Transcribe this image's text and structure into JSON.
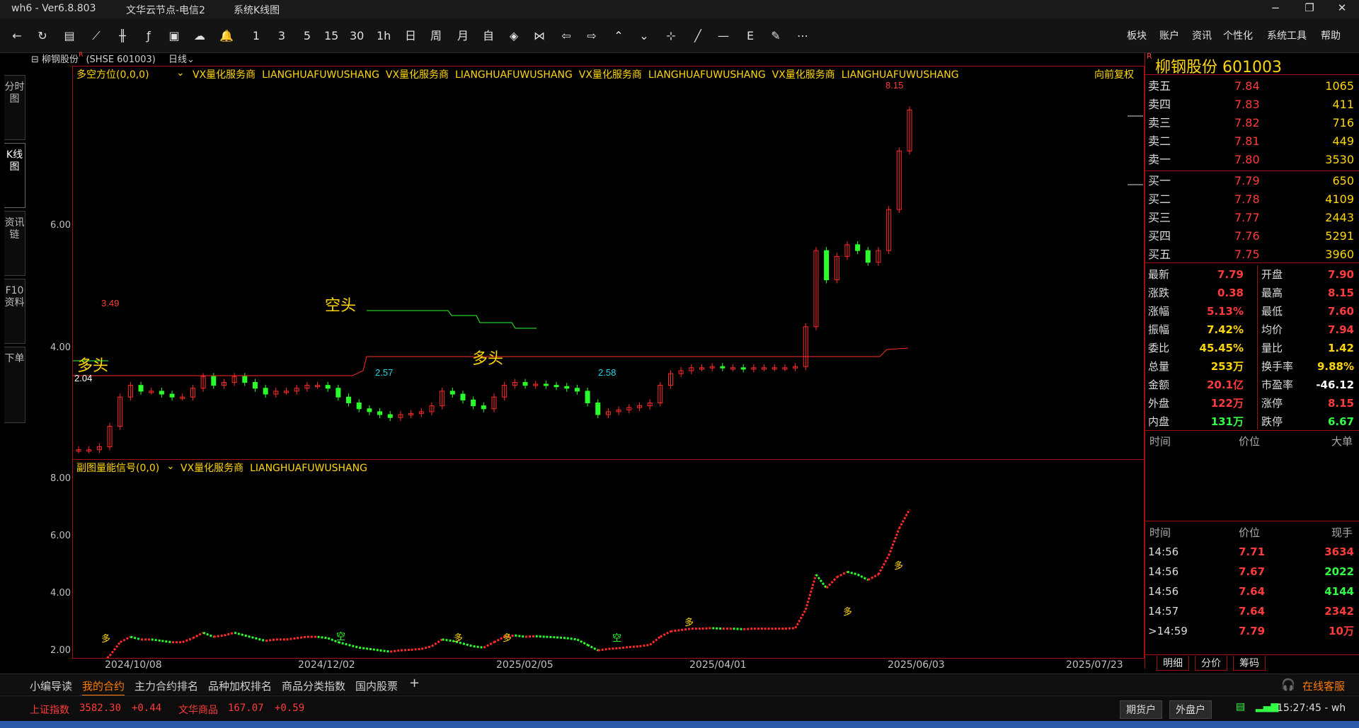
{
  "window": {
    "app": "wh6  -  Ver6.8.803",
    "server": "文华云节点-电信2",
    "view": "系统K线图",
    "controls": [
      "−",
      "❐",
      "✕"
    ]
  },
  "toolbar": {
    "icons": [
      "back-icon",
      "refresh-icon",
      "table-icon",
      "line-chart-icon",
      "candle-icon",
      "indicator-icon",
      "calc-icon",
      "cloud-icon",
      "bell-icon"
    ],
    "periods": [
      "1",
      "3",
      "5",
      "15",
      "30",
      "1h",
      "日",
      "周",
      "月",
      "自"
    ],
    "menus": [
      "板块",
      "账户",
      "资讯",
      "个性化",
      "系统工具",
      "帮助"
    ]
  },
  "sidetabs": [
    "分时图",
    "K线图",
    "资讯链",
    "F10资料",
    "下单"
  ],
  "instrument": {
    "name": "柳钢股份",
    "code_label": "(SHSE 601003)",
    "period": "日线"
  },
  "main_chart": {
    "indicator": "多空方位(0,0,0)",
    "promo": [
      "VX量化服务商",
      "LIANGHUAFUWUSHANG",
      "VX量化服务商",
      "LIANGHUAFUWUSHANG",
      "VX量化服务商",
      "LIANGHUAFUWUSHANG",
      "VX量化服务商",
      "LIANGHUAFUWUSHANG"
    ],
    "adjust": "向前复权",
    "yticks": [
      "6.00",
      "4.00"
    ],
    "labels": {
      "high": "8.15",
      "local_high": "3.49",
      "low1": "2.57",
      "low2": "2.58",
      "start": "2.04"
    },
    "signals": {
      "kong": "空头",
      "duo1": "多头",
      "duo2": "多头"
    }
  },
  "sub_chart": {
    "indicator": "副图量能信号(0,0)",
    "promo": [
      "VX量化服务商",
      "LIANGHUAFUWUSHANG"
    ],
    "yticks": [
      "8.00",
      "6.00",
      "4.00",
      "2.00"
    ],
    "markers": [
      "多",
      "空",
      "多",
      "多",
      "空",
      "多",
      "多",
      "多"
    ]
  },
  "xaxis": [
    "2024/10/08",
    "2024/12/02",
    "2025/02/05",
    "2025/04/01",
    "2025/06/03",
    "2025/07/23"
  ],
  "quote": {
    "title": "柳钢股份  601003",
    "asks": [
      {
        "label": "卖五",
        "price": "7.84",
        "vol": "1065"
      },
      {
        "label": "卖四",
        "price": "7.83",
        "vol": "411"
      },
      {
        "label": "卖三",
        "price": "7.82",
        "vol": "716"
      },
      {
        "label": "卖二",
        "price": "7.81",
        "vol": "449"
      },
      {
        "label": "卖一",
        "price": "7.80",
        "vol": "3530"
      }
    ],
    "bids": [
      {
        "label": "买一",
        "price": "7.79",
        "vol": "650"
      },
      {
        "label": "买二",
        "price": "7.78",
        "vol": "4109"
      },
      {
        "label": "买三",
        "price": "7.77",
        "vol": "2443"
      },
      {
        "label": "买四",
        "price": "7.76",
        "vol": "5291"
      },
      {
        "label": "买五",
        "price": "7.75",
        "vol": "3960"
      }
    ],
    "stats": [
      {
        "l1": "最新",
        "v1": "7.79",
        "c1": "red",
        "l2": "开盘",
        "v2": "7.90",
        "c2": "red"
      },
      {
        "l1": "涨跌",
        "v1": "0.38",
        "c1": "red",
        "l2": "最高",
        "v2": "8.15",
        "c2": "red"
      },
      {
        "l1": "涨幅",
        "v1": "5.13%",
        "c1": "red",
        "l2": "最低",
        "v2": "7.60",
        "c2": "red"
      },
      {
        "l1": "振幅",
        "v1": "7.42%",
        "c1": "yellow",
        "l2": "均价",
        "v2": "7.94",
        "c2": "red"
      },
      {
        "l1": "委比",
        "v1": "45.45%",
        "c1": "yellow",
        "l2": "量比",
        "v2": "1.42",
        "c2": "yellow"
      },
      {
        "l1": "总量",
        "v1": "253万",
        "c1": "yellow",
        "l2": "换手率",
        "v2": "9.88%",
        "c2": "yellow"
      },
      {
        "l1": "金额",
        "v1": "20.1亿",
        "c1": "red",
        "l2": "市盈率",
        "v2": "-46.12",
        "c2": "white"
      },
      {
        "l1": "外盘",
        "v1": "122万",
        "c1": "red",
        "l2": "涨停",
        "v2": "8.15",
        "c2": "red"
      },
      {
        "l1": "内盘",
        "v1": "131万",
        "c1": "green",
        "l2": "跌停",
        "v2": "6.67",
        "c2": "green"
      }
    ],
    "big_hdr": [
      "时间",
      "价位",
      "大单"
    ],
    "tick_hdr": [
      "时间",
      "价位",
      "现手"
    ],
    "ticks": [
      {
        "t": "14:56",
        "p": "7.71",
        "v": "3634",
        "c": "red"
      },
      {
        "t": "14:56",
        "p": "7.67",
        "v": "2022",
        "c": "green"
      },
      {
        "t": "14:56",
        "p": "7.64",
        "v": "4144",
        "c": "green"
      },
      {
        "t": "14:57",
        "p": "7.64",
        "v": "2342",
        "c": "red"
      },
      {
        "t": ">14:59",
        "p": "7.79",
        "v": "10万",
        "c": "red"
      }
    ],
    "tabs": [
      "明细",
      "分价",
      "筹码"
    ]
  },
  "bottom_tabs": [
    "小编导读",
    "我的合约",
    "主力合约排名",
    "品种加权排名",
    "商品分类指数",
    "国内股票",
    "+"
  ],
  "service": "在线客服",
  "status": {
    "idx1_name": "上证指数",
    "idx1_val": "3582.30",
    "idx1_chg": "+0.44",
    "idx2_name": "文华商品",
    "idx2_val": "167.07",
    "idx2_chg": "+0.59",
    "btn1": "期货户",
    "btn2": "外盘户",
    "time": "15:27:45 - wh"
  }
}
